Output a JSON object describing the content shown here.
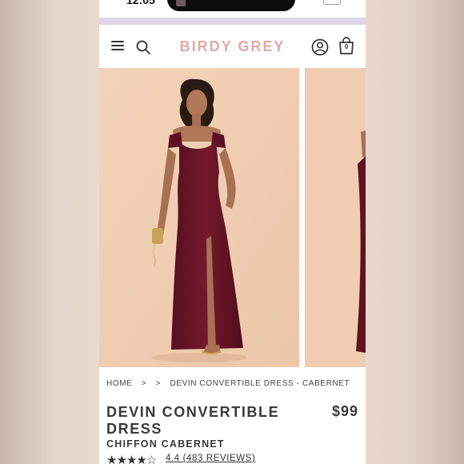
{
  "status_bar": {
    "time": "12:05"
  },
  "header": {
    "brand": "BIRDY GREY",
    "cart_count": "0"
  },
  "breadcrumb": {
    "home": "HOME",
    "separator": ">",
    "current": "DEVIN CONVERTIBLE DRESS - CABERNET"
  },
  "product": {
    "title": "DEVIN CONVERTIBLE DRESS",
    "price": "$99",
    "subtitle": "CHIFFON CABERNET",
    "rating_text": "4.4 (483 REVIEWS)"
  },
  "colors": {
    "brand": "#e3a8a3",
    "dress": "#6b1525",
    "photo_bg": "#f0cdb0",
    "promo_strip": "#dcd6e6"
  }
}
